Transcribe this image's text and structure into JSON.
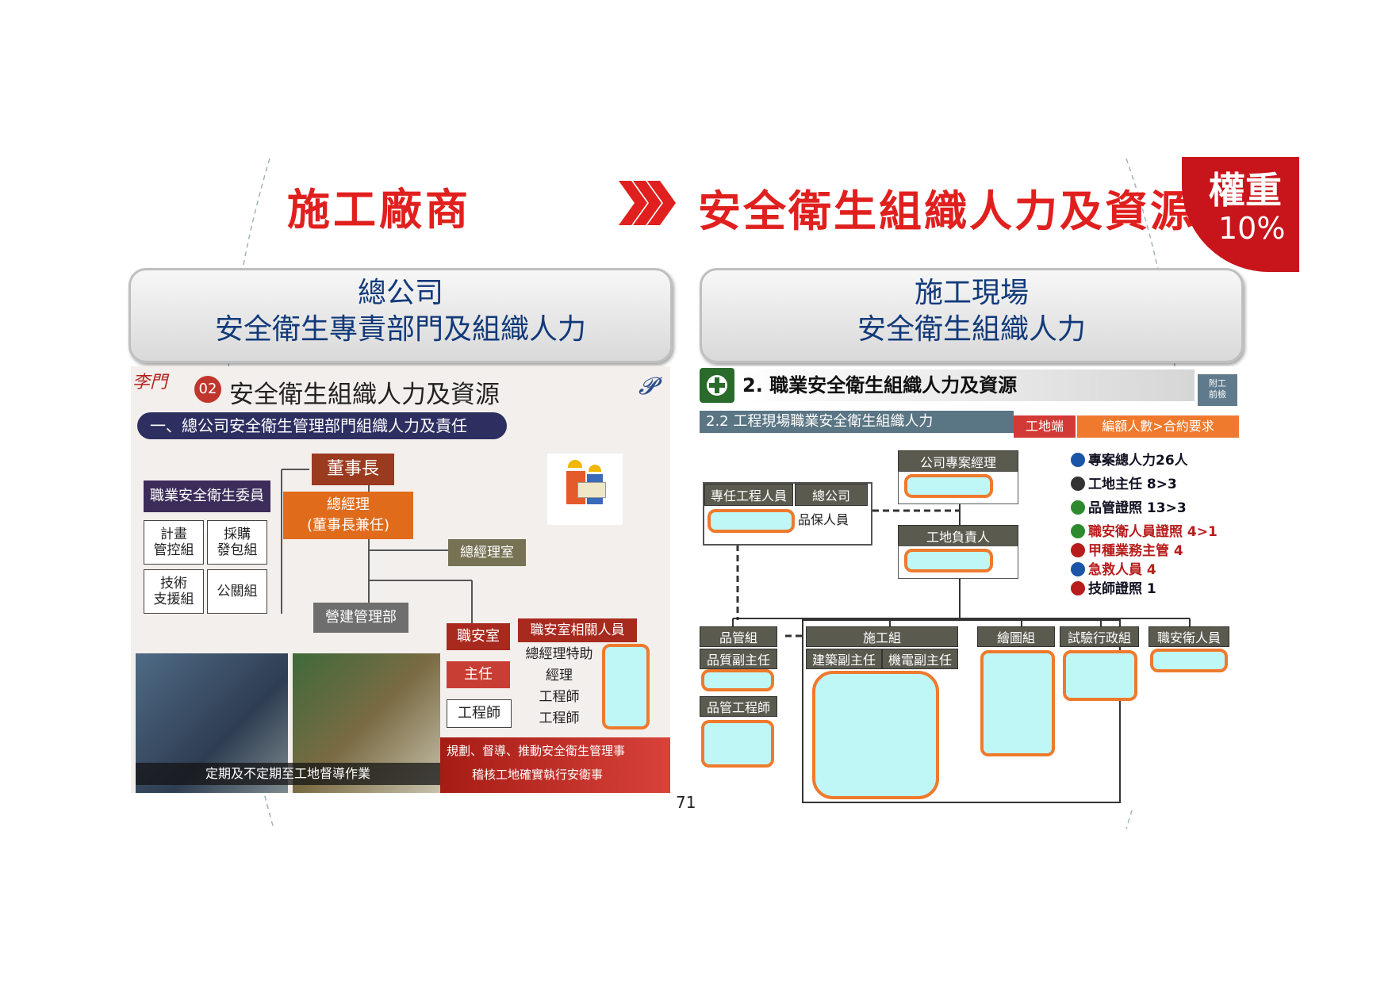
{
  "header": {
    "left_title": "施工廠商",
    "right_title": "安全衛生組織人力及資源",
    "weight_label": "權重",
    "weight_value": "10%"
  },
  "left_panel": {
    "pill_line1": "總公司",
    "pill_line2": "安全衛生專責部門及組織人力",
    "logo_text": "李門",
    "badge_number": "02",
    "slide_title": "安全衛生組織人力及資源",
    "subtitle": "一、總公司安全衛生管理部門組織人力及責任",
    "chairman": "董事長",
    "gm_line1": "總經理",
    "gm_line2": "(董事長兼任)",
    "committee": "職業安全衛生委員會",
    "cells": [
      {
        "l1": "計畫",
        "l2": "管控組"
      },
      {
        "l1": "採購",
        "l2": "發包組"
      },
      {
        "l1": "技術",
        "l2": "支援組"
      },
      {
        "l1": "公關組",
        "l2": ""
      }
    ],
    "gm_office": "總經理室",
    "construction_dept": "營建管理部",
    "safety_office": "職安室",
    "director": "主任",
    "engineer": "工程師",
    "staff_header": "職安室相關人員",
    "staff": [
      "總經理特助",
      "經理",
      "工程師",
      "工程師"
    ],
    "caption_photo": "定期及不定期至工地督導作業",
    "caption_right1": "規劃、督導、推動安全衛生管理事",
    "caption_right2": "稽核工地確實執行安衛事"
  },
  "right_panel": {
    "pill_line1": "施工現場",
    "pill_line2": "安全衛生組織人力",
    "slide_title": "2. 職業安全衛生組織人力及資源",
    "tag_label": "附工\n前檢",
    "subtitle": "2.2 工程現場職業安全衛生組織人力",
    "red_tag": "工地端",
    "orange_tag": "編額人數>合約要求",
    "company_manager": "公司專案經理",
    "site_director": "工地負責人",
    "engineer_box_a": "專任工程人員",
    "engineer_box_b": "總公司",
    "qa_person": "品保人員",
    "legend": [
      {
        "text": "專案總人力26人",
        "color": "#1b55a8"
      },
      {
        "text": "工地主任 8>3",
        "color": "#333333"
      },
      {
        "text": "品管證照 13>3",
        "color": "#2e8a2e"
      },
      {
        "text": "職安衛人員證照 4>1",
        "color": "#b81c1c"
      },
      {
        "text": "甲種業務主管 4",
        "color": "#b81c1c"
      },
      {
        "text": "急救人員 4",
        "color": "#1b55a8"
      },
      {
        "text": "技師證照 1",
        "color": "#b81c1c"
      }
    ],
    "groups": [
      "品管組",
      "施工組",
      "繪圖組",
      "試驗行政組",
      "職安衛人員"
    ],
    "qc_sub1": "品質副主任",
    "qc_sub2": "品管工程師",
    "build_sub1": "建築副主任",
    "build_sub2": "機電副主任"
  },
  "page_number": "71"
}
